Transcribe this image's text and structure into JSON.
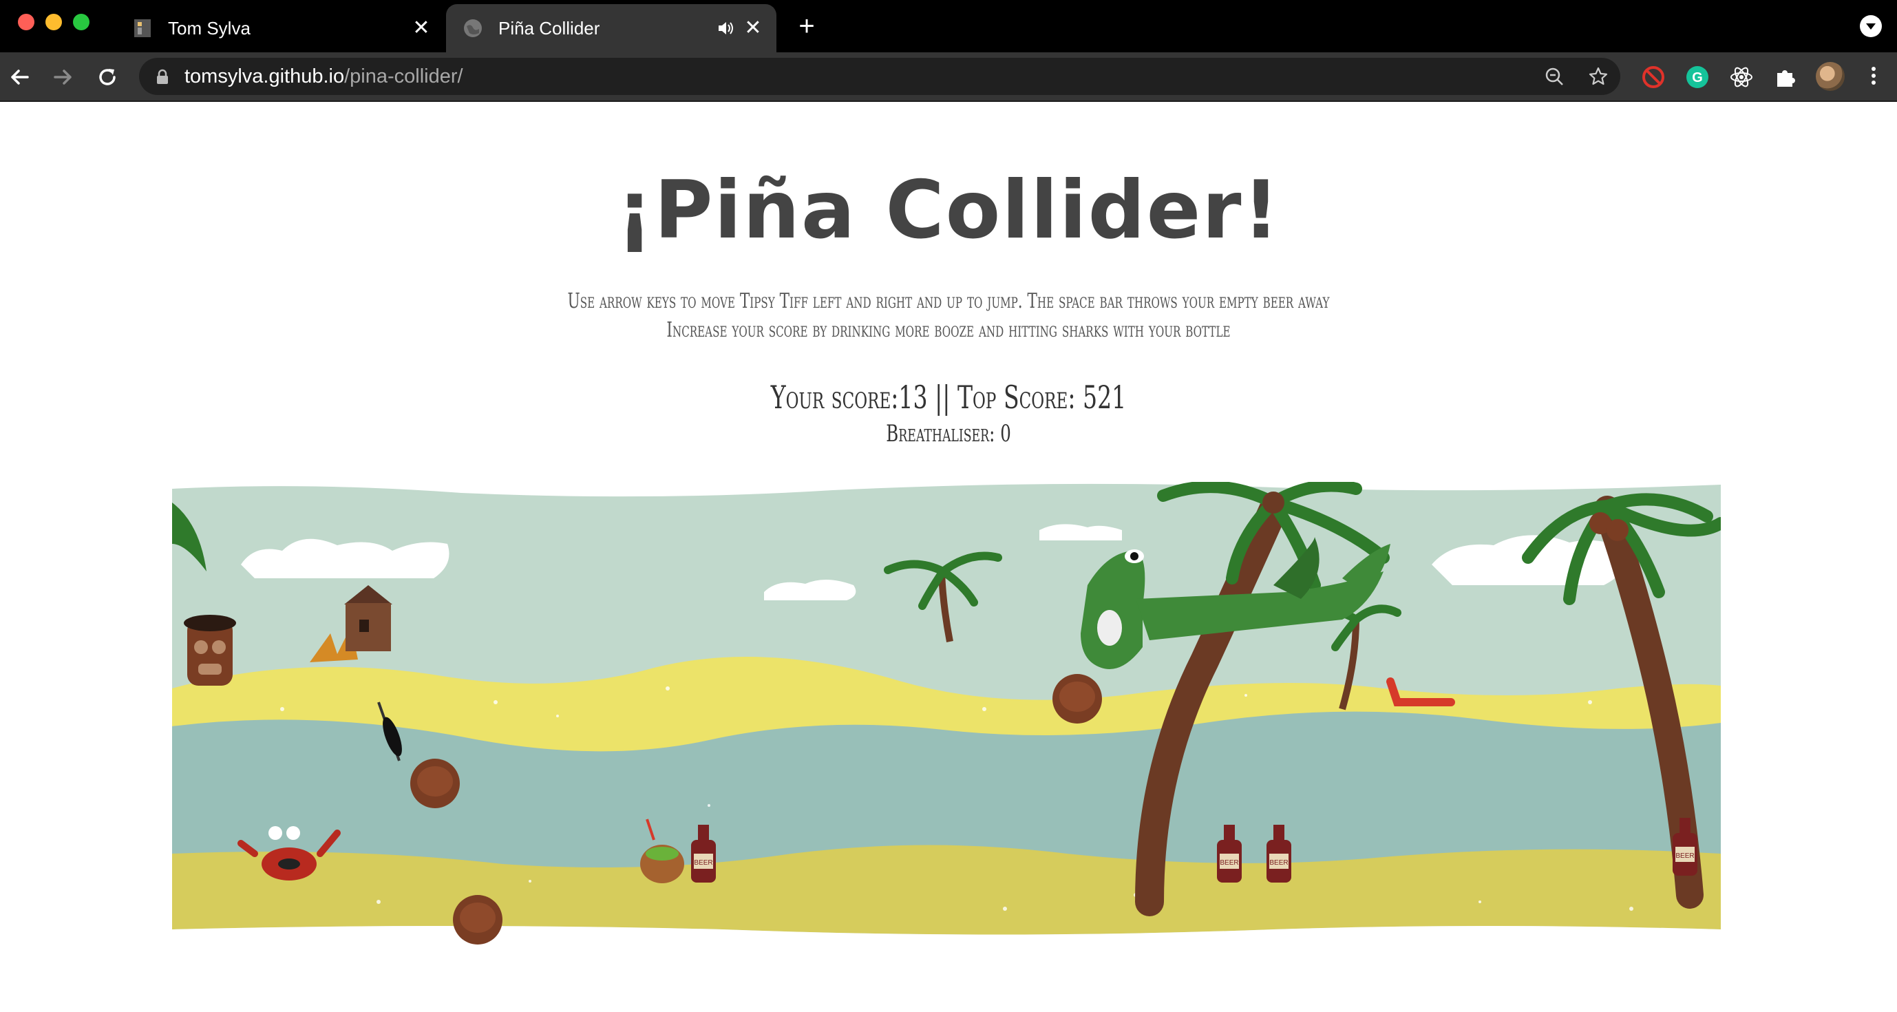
{
  "browser": {
    "tabs": [
      {
        "title": "Tom Sylva",
        "active": false
      },
      {
        "title": "Piña Collider",
        "active": true
      }
    ],
    "url_host": "tomsylva.github.io",
    "url_path": "/pina-collider/"
  },
  "game": {
    "title": "¡Piña Collider!",
    "instructions_line1": "Use arrow keys to move Tipsy Tiff left and right and up to jump. The space bar throws your empty beer away",
    "instructions_line2": "Increase your score by drinking more booze and hitting sharks with your bottle",
    "score_text": "Your score:13 || Top Score: 521",
    "breathaliser_text": "Breathaliser: 0",
    "bottle_label": "BEER"
  },
  "colors": {
    "sky": "#c1d9cc",
    "sand": "#ece369",
    "sea": "#98bfb8",
    "front_sand": "#d6cc5c",
    "shark": "#3f8a39",
    "coconut": "#7a3d23",
    "bottle": "#7a2020",
    "palm_trunk": "#6b3a24",
    "palm_leaf": "#2f7a2b"
  },
  "icons": {
    "tab1_favicon": "monitor-favicon-icon",
    "tab2_favicon": "globe-icon",
    "audio": "speaker-icon",
    "close": "close-icon",
    "back": "back-arrow-icon",
    "forward": "forward-arrow-icon",
    "reload": "reload-icon",
    "lock": "lock-icon",
    "zoom": "zoom-out-icon",
    "star": "bookmark-star-icon",
    "block": "block-extension-icon",
    "grammarly": "grammarly-icon",
    "react": "react-devtools-icon",
    "extensions": "puzzle-extensions-icon"
  }
}
